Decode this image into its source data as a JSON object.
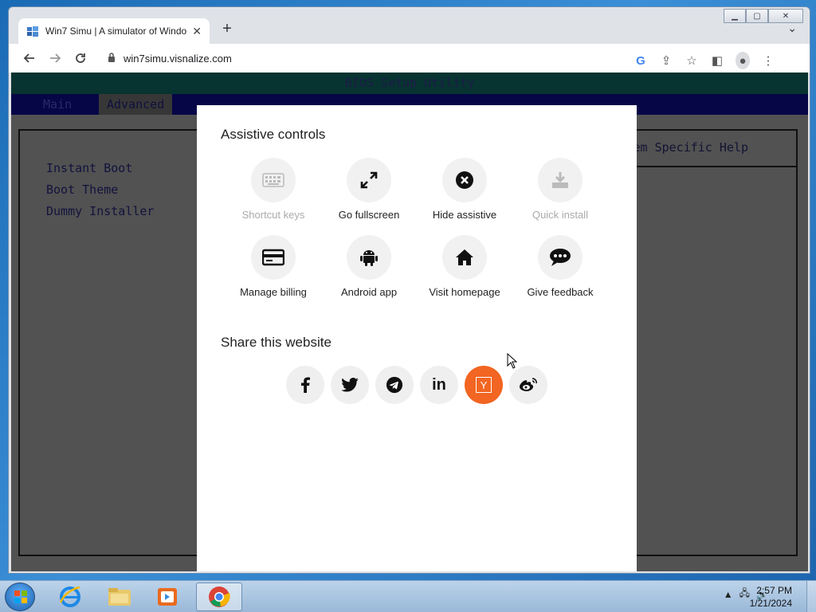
{
  "browser": {
    "tab_title": "Win7 Simu | A simulator of Windo",
    "url": "win7simu.visnalize.com",
    "new_tab_symbol": "+",
    "tab_dropdown_symbol": "⌄"
  },
  "bios": {
    "title": "BIOS Setup Utility",
    "menu": [
      "Main",
      "Advanced"
    ],
    "active_menu_index": 1,
    "items": [
      "Instant Boot",
      "Boot Theme",
      "Dummy Installer"
    ],
    "help_title": "Item Specific Help"
  },
  "modal": {
    "assistive_title": "Assistive controls",
    "controls": [
      {
        "label": "Shortcut keys",
        "icon": "keyboard-icon",
        "disabled": true
      },
      {
        "label": "Go fullscreen",
        "icon": "fullscreen-icon",
        "disabled": false
      },
      {
        "label": "Hide assistive",
        "icon": "close-circle-icon",
        "disabled": false
      },
      {
        "label": "Quick install",
        "icon": "download-icon",
        "disabled": true
      },
      {
        "label": "Manage billing",
        "icon": "credit-card-icon",
        "disabled": false
      },
      {
        "label": "Android app",
        "icon": "android-icon",
        "disabled": false
      },
      {
        "label": "Visit homepage",
        "icon": "home-icon",
        "disabled": false
      },
      {
        "label": "Give feedback",
        "icon": "chat-bubble-icon",
        "disabled": false
      }
    ],
    "share_title": "Share this website",
    "share": [
      {
        "name": "facebook",
        "icon": "facebook-icon"
      },
      {
        "name": "twitter",
        "icon": "twitter-icon"
      },
      {
        "name": "telegram",
        "icon": "telegram-icon"
      },
      {
        "name": "linkedin",
        "icon": "linkedin-icon",
        "glyph": "in"
      },
      {
        "name": "ycombinator",
        "icon": "ycombinator-icon",
        "glyph": "Y"
      },
      {
        "name": "weibo",
        "icon": "weibo-icon"
      }
    ]
  },
  "taskbar": {
    "time": "2:57 PM",
    "date": "1/21/2024",
    "apps": [
      "internet-explorer",
      "file-explorer",
      "media-player",
      "chrome"
    ]
  },
  "colors": {
    "accent_orange": "#f26522",
    "bios_blue": "#0a0a6e",
    "bios_teal": "#0b4f4a"
  }
}
